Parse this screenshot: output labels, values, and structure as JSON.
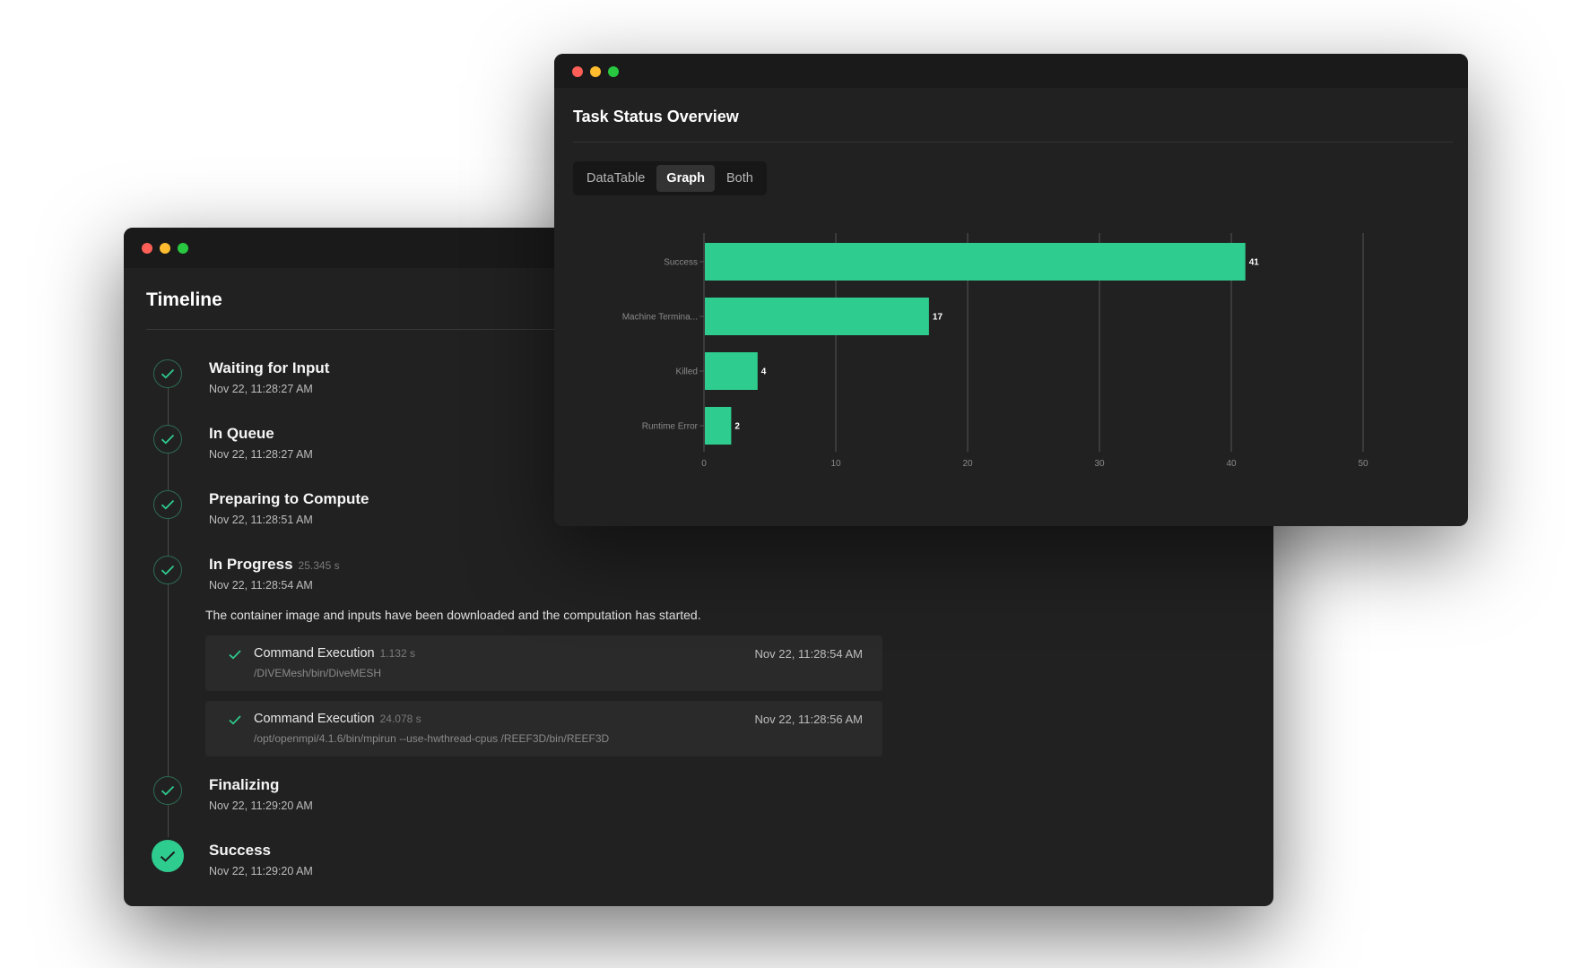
{
  "timeline_window": {
    "title": "Timeline",
    "steps": [
      {
        "title": "Waiting for Input",
        "duration": "",
        "time": "Nov 22, 11:28:27 AM"
      },
      {
        "title": "In Queue",
        "duration": "",
        "time": "Nov 22, 11:28:27 AM"
      },
      {
        "title": "Preparing to Compute",
        "duration": "",
        "time": "Nov 22, 11:28:51 AM"
      },
      {
        "title": "In Progress",
        "duration": "25.345 s",
        "time": "Nov 22, 11:28:54 AM"
      },
      {
        "title": "Finalizing",
        "duration": "",
        "time": "Nov 22, 11:29:20 AM"
      },
      {
        "title": "Success",
        "duration": "",
        "time": "Nov 22, 11:29:20 AM"
      }
    ],
    "in_progress_description": "The container image and inputs have been downloaded and the computation has started.",
    "commands": [
      {
        "title": "Command Execution",
        "duration": "1.132 s",
        "path": "/DIVEMesh/bin/DiveMESH",
        "time": "Nov 22, 11:28:54 AM"
      },
      {
        "title": "Command Execution",
        "duration": "24.078 s",
        "path": "/opt/openmpi/4.1.6/bin/mpirun --use-hwthread-cpus /REEF3D/bin/REEF3D",
        "time": "Nov 22, 11:28:56 AM"
      }
    ]
  },
  "status_window": {
    "title": "Task Status Overview",
    "tabs": [
      {
        "label": "DataTable",
        "active": false
      },
      {
        "label": "Graph",
        "active": true
      },
      {
        "label": "Both",
        "active": false
      }
    ]
  },
  "colors": {
    "accent": "#2ecc8e",
    "window_bg": "#212121",
    "titlebar_bg": "#1a1a1a"
  },
  "chart_data": {
    "type": "bar",
    "orientation": "horizontal",
    "categories": [
      "Success",
      "Machine Termina...",
      "Killed",
      "Runtime Error"
    ],
    "values": [
      41,
      17,
      4,
      2
    ],
    "xlim": [
      0,
      50
    ],
    "xticks": [
      0,
      10,
      20,
      30,
      40,
      50
    ],
    "grid": true,
    "title": "",
    "xlabel": "",
    "ylabel": ""
  }
}
